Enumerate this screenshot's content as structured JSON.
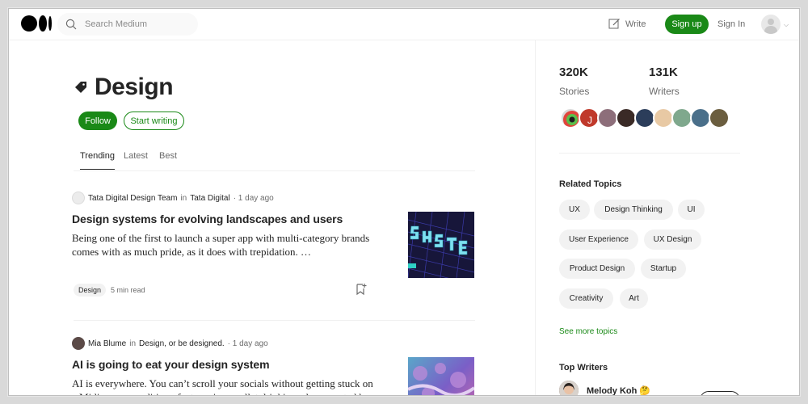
{
  "header": {
    "search_placeholder": "Search Medium",
    "write_label": "Write",
    "signup_label": "Sign up",
    "signin_label": "Sign In"
  },
  "topic": {
    "title": "Design",
    "follow_label": "Follow",
    "start_writing_label": "Start writing"
  },
  "tabs": [
    {
      "label": "Trending",
      "active": true
    },
    {
      "label": "Latest",
      "active": false
    },
    {
      "label": "Best",
      "active": false
    }
  ],
  "articles": [
    {
      "author": "Tata Digital Design Team",
      "in_word": "in",
      "publication": "Tata Digital",
      "time": "· 1 day ago",
      "title": "Design systems for evolving landscapes and users",
      "excerpt": "Being one of the first to launch a super app with multi-category brands comes with as much pride, as it does with trepidation. …",
      "tag": "Design",
      "read_time": "5 min read"
    },
    {
      "author": "Mia Blume",
      "in_word": "in",
      "publication": "Design, or be designed.",
      "time": "· 1 day ago",
      "title": "AI is going to eat your design system",
      "excerpt": "AI is everywhere. You can’t scroll your socials without getting stuck on a Midjourney rendition of a t-rex in a mullet drinking a beer, posted by"
    }
  ],
  "stats": {
    "stories_value": "320K",
    "stories_label": "Stories",
    "writers_value": "131K",
    "writers_label": "Writers"
  },
  "related": {
    "heading": "Related Topics",
    "topics": [
      "UX",
      "Design Thinking",
      "UI",
      "User Experience",
      "UX Design",
      "Product Design",
      "Startup",
      "Creativity",
      "Art"
    ],
    "see_more": "See more topics"
  },
  "top_writers": {
    "heading": "Top Writers",
    "first_name": "Melody Koh 🤔"
  },
  "colors": {
    "brand_green": "#1a8917",
    "text": "#242424",
    "muted": "#6b6b6b",
    "chip_bg": "#f2f2f2"
  }
}
